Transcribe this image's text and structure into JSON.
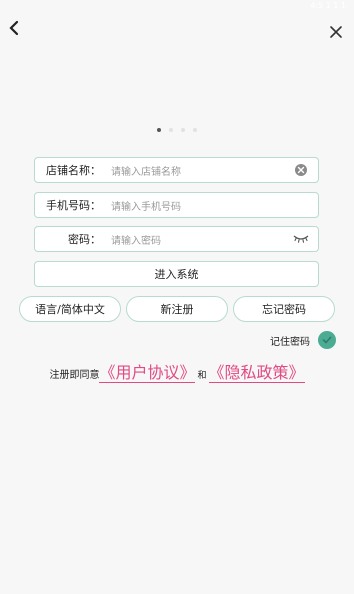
{
  "status_bar": {
    "left": "",
    "right": "4:5 1 1 1"
  },
  "nav": {
    "back_icon": "chevron-left-icon",
    "close_icon": "close-icon"
  },
  "carousel": {
    "dots": 4,
    "active_index": 0
  },
  "form": {
    "shop_name": {
      "label": "店铺名称：",
      "placeholder": "请输入店铺名称"
    },
    "phone": {
      "label": "手机号码：",
      "placeholder": "请输入手机号码"
    },
    "password": {
      "label": "密码：",
      "placeholder": "请输入密码"
    }
  },
  "buttons": {
    "enter": "进入系统",
    "language": "语言/简体中文",
    "register": "新注册",
    "forgot": "忘记密码"
  },
  "remember": {
    "label": "记住密码",
    "checked": true
  },
  "agreement": {
    "prefix": "注册即同意",
    "user_agreement": "《用户协议》",
    "and": "和",
    "privacy_policy": "《隐私政策》"
  },
  "colors": {
    "accent": "#4bab93",
    "border": "#b7dccf",
    "link": "#e24a82"
  }
}
